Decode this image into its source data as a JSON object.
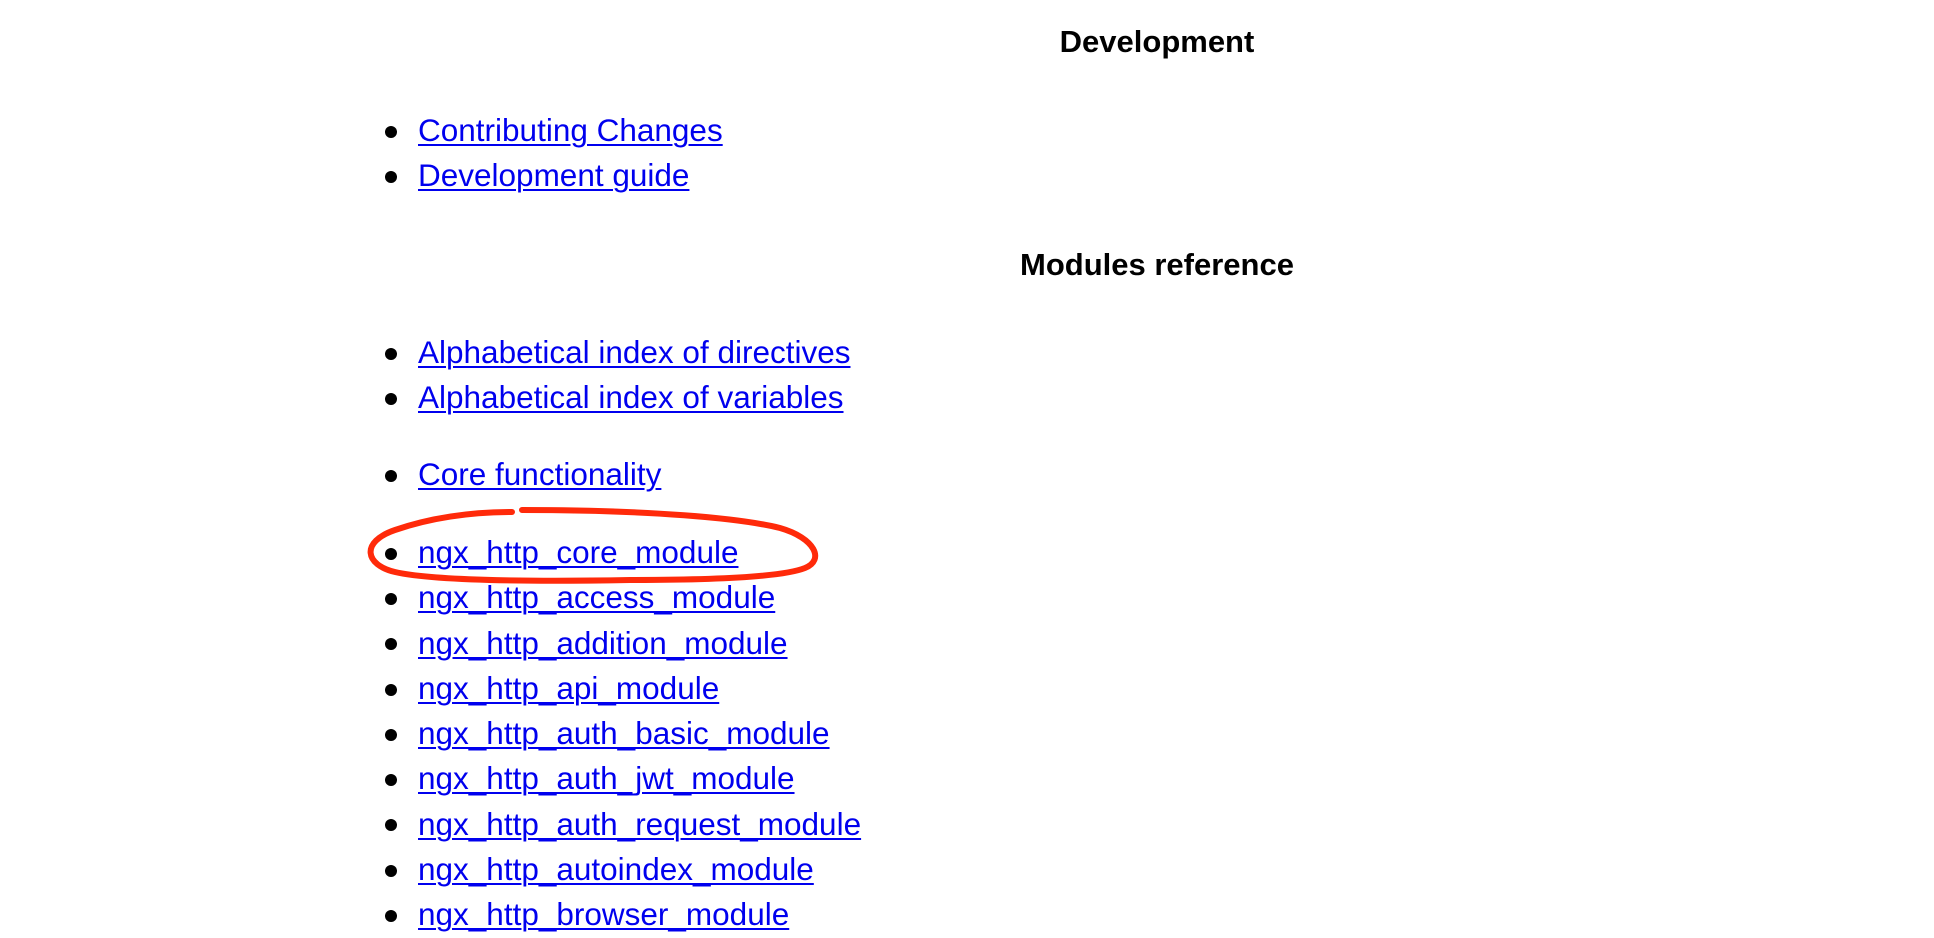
{
  "sections": {
    "development": {
      "heading": "Development",
      "links": [
        "Contributing Changes",
        "Development guide"
      ]
    },
    "modules_reference": {
      "heading": "Modules reference",
      "index_links": [
        "Alphabetical index of directives",
        "Alphabetical index of variables"
      ],
      "core_links": [
        "Core functionality"
      ],
      "module_links": [
        "ngx_http_core_module",
        "ngx_http_access_module",
        "ngx_http_addition_module",
        "ngx_http_api_module",
        "ngx_http_auth_basic_module",
        "ngx_http_auth_jwt_module",
        "ngx_http_auth_request_module",
        "ngx_http_autoindex_module",
        "ngx_http_browser_module"
      ]
    }
  },
  "annotation": {
    "type": "hand-drawn-circle",
    "target": "ngx_http_core_module",
    "color": "#ff2a0a"
  },
  "colors": {
    "link": "#0000ee",
    "text": "#000000",
    "background": "#ffffff"
  }
}
